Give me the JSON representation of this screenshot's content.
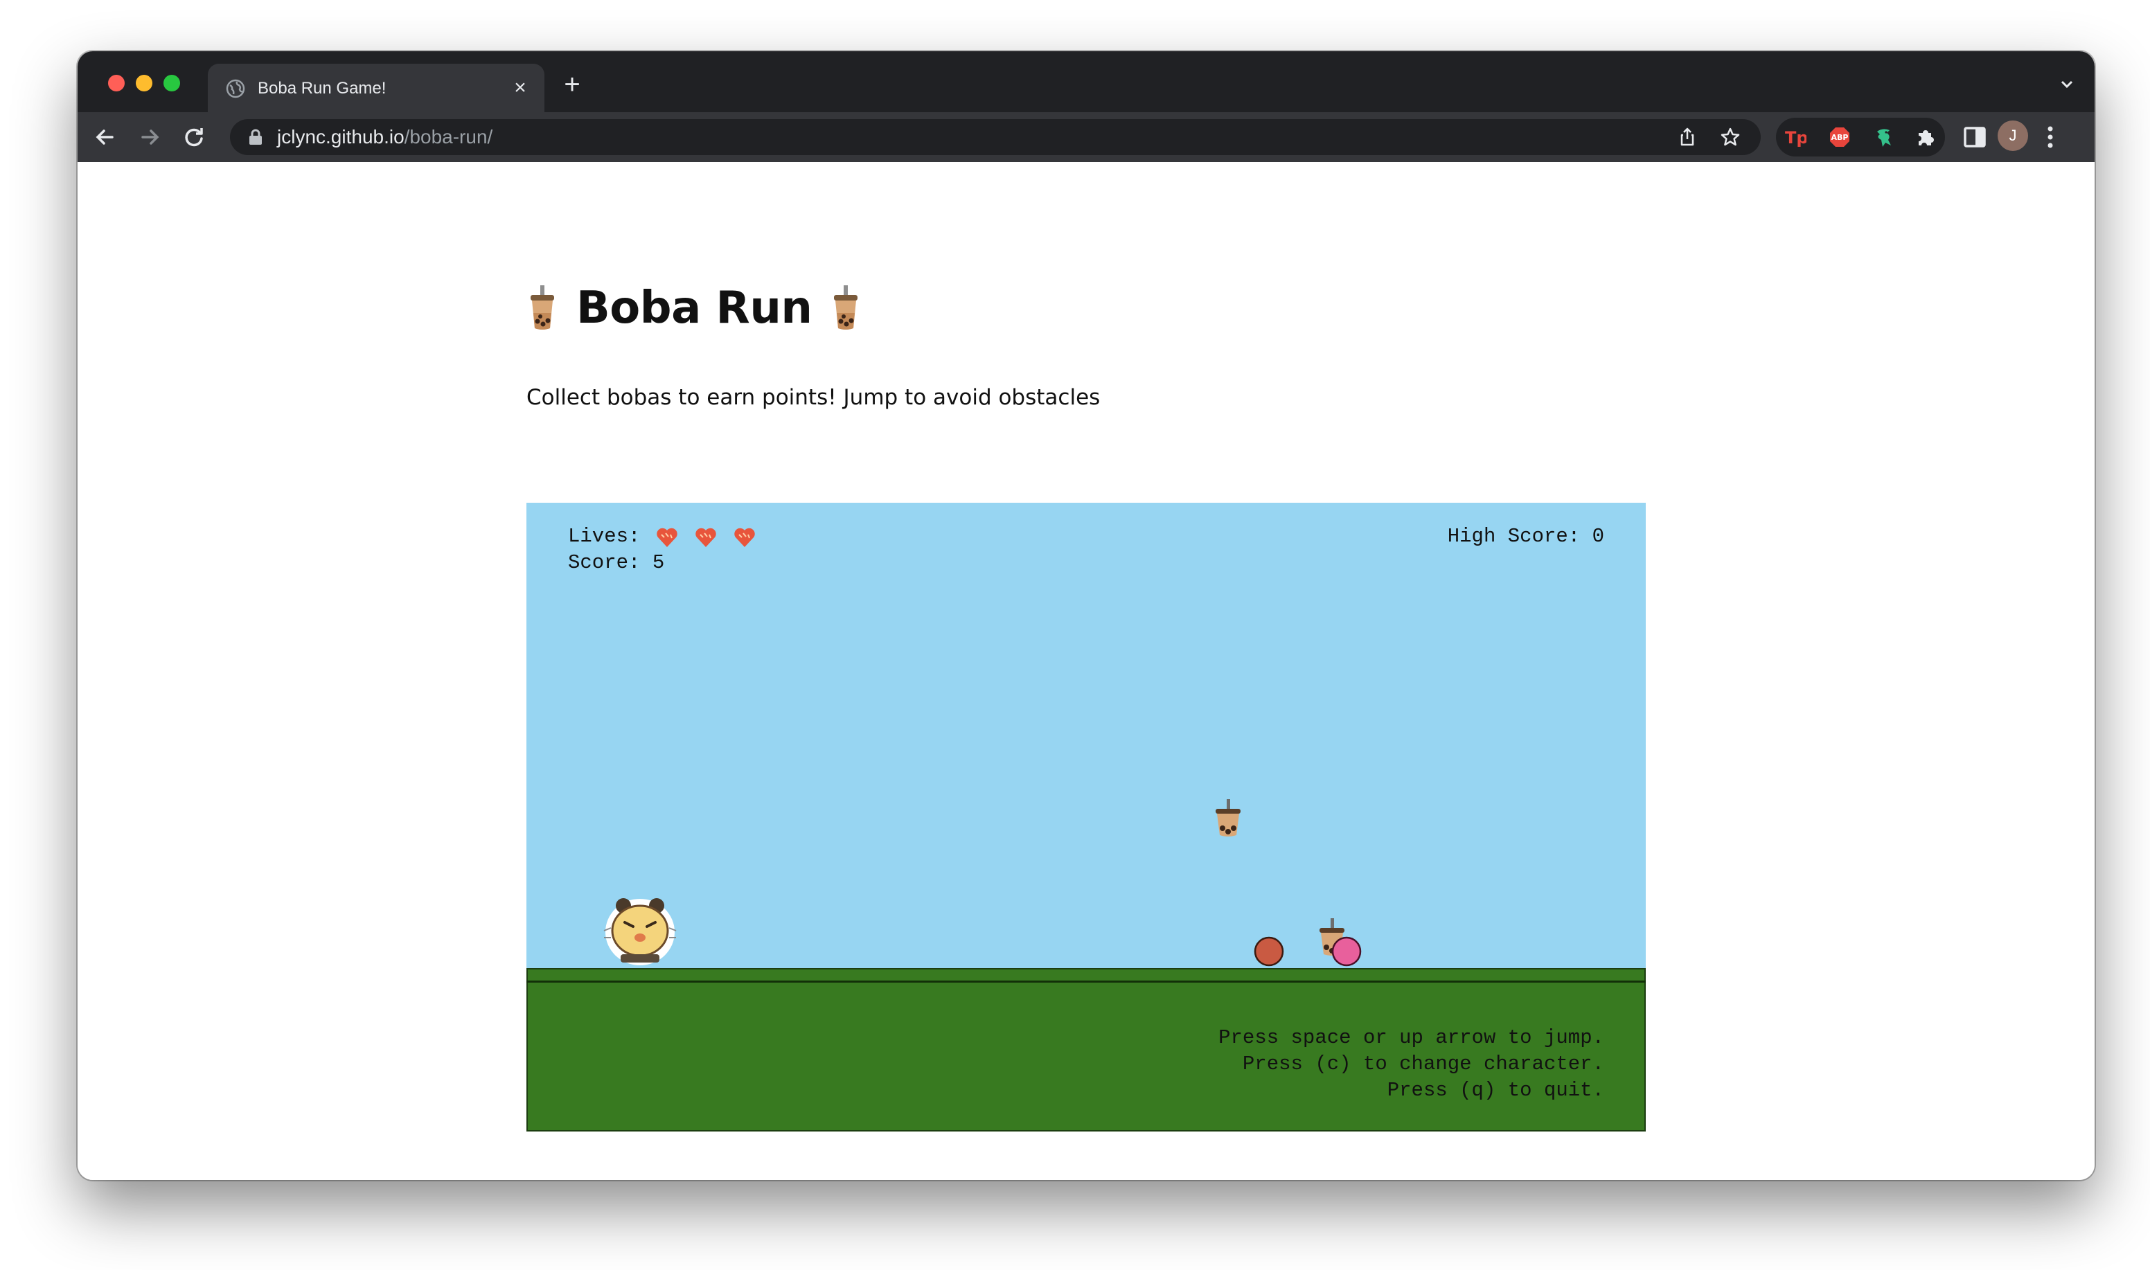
{
  "browser": {
    "tab_title": "Boba Run Game!",
    "url_host": "jclync.github.io",
    "url_path": "/boba-run/",
    "avatar_initial": "J",
    "colors": {
      "tabstrip": "#202124",
      "toolbar": "#35363a"
    },
    "extensions": [
      "tp-extension-icon",
      "adblock-plus-icon",
      "dragon-extension-icon",
      "puzzle-piece-icon"
    ]
  },
  "page": {
    "title": "Boba Run",
    "subtitle": "Collect bobas to earn points! Jump to avoid obstacles"
  },
  "game": {
    "lives_label": "Lives:",
    "lives": 3,
    "score_label": "Score: 5",
    "high_score_label": "High Score: 0",
    "instructions": [
      "Press space or up arrow to jump.",
      "Press (c) to change character.",
      "Press (q) to quit."
    ],
    "colors": {
      "sky": "#97d5f2",
      "ground": "#387a20",
      "obstacle_red": "#c95a42",
      "obstacle_pink": "#e8609c"
    }
  }
}
